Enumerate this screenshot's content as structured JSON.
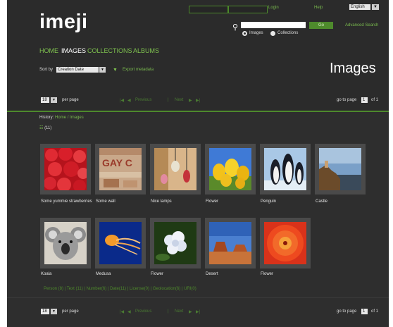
{
  "header": {
    "logo": "imeji",
    "login_label": "Login",
    "help_label": "Help",
    "language": "English",
    "search_go_label": "Go",
    "advanced_search_label": "Advanced Search",
    "search_options": [
      "Images",
      "Collections"
    ],
    "search_selected": "Images"
  },
  "nav": {
    "items": [
      "HOME",
      "IMAGES",
      "COLLECTIONS",
      "ALBUMS"
    ],
    "active": "IMAGES"
  },
  "toolbar": {
    "sort_label": "Sort by",
    "sort_value": "Creation Date",
    "export_label": "Export metadata"
  },
  "page_title": "Images",
  "pagination_top": {
    "per_page_value": "18",
    "per_page_label": "per page",
    "first": "|◀",
    "prev_arrow": "◀",
    "prev_label": "Previous",
    "page_sep": "|",
    "next_label": "Next",
    "next_arrow": "▶",
    "last": "▶|",
    "goto_label": "go to page",
    "goto_value": "1",
    "of_label": "of 1"
  },
  "pagination_bottom": {
    "per_page_value": "18",
    "per_page_label": "per page",
    "first": "|◀",
    "prev_arrow": "◀",
    "prev_label": "Previous",
    "page_sep": "|",
    "next_label": "Next",
    "next_arrow": "▶",
    "last": "▶|",
    "goto_label": "go to page",
    "goto_value": "1",
    "of_label": "of 1"
  },
  "breadcrumb": {
    "label": "History:",
    "items": [
      "Home",
      "Images"
    ],
    "sep": "/"
  },
  "result_count": "(11)",
  "images": [
    {
      "caption": "Some yummie strawberries"
    },
    {
      "caption": "Some wall"
    },
    {
      "caption": "Nice lamps"
    },
    {
      "caption": "Flower"
    },
    {
      "caption": "Penguin"
    },
    {
      "caption": "Castle"
    },
    {
      "caption": "Koala"
    },
    {
      "caption": "Medusa"
    },
    {
      "caption": "Flower"
    },
    {
      "caption": "Desert"
    },
    {
      "caption": "Flower"
    }
  ],
  "facets": "Person (8) | Text (11) | Number(6) | Date(11) | License(0) | Geolocation(6) | URI(0)",
  "colors": {
    "accent_green": "#7fc24f",
    "link_green": "#79b94e",
    "background": "#2e2e2e"
  }
}
